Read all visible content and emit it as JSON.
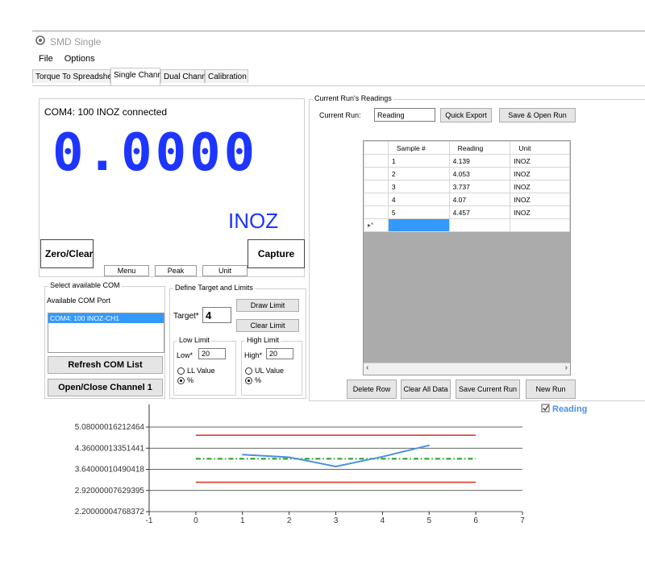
{
  "window": {
    "title": "SMD Single"
  },
  "menu": [
    "File",
    "Options"
  ],
  "tabs": [
    "Torque To Spreadsheet",
    "Single Channel",
    "Dual Channel",
    "Calibration"
  ],
  "display": {
    "status": "COM4: 100 INOZ connected",
    "reading": "0.0000",
    "unit": "INOZ",
    "zero_clear": "Zero/Clear",
    "capture": "Capture",
    "menu_btn": "Menu",
    "peak_btn": "Peak",
    "unit_btn": "Unit"
  },
  "com": {
    "group_title": "Select available COM",
    "label": "Available COM Port",
    "ports": [
      "COM4: 100 INOZ-CH1"
    ],
    "refresh": "Refresh COM List",
    "open_close": "Open/Close Channel 1"
  },
  "target": {
    "group_title": "Define Target and Limits",
    "target_label": "Target*",
    "target_value": "4",
    "draw_limit": "Draw Limit",
    "clear_limit": "Clear Limit",
    "low": {
      "title": "Low Limit",
      "label": "Low*",
      "value": "20",
      "opt1": "LL Value",
      "opt2": "%"
    },
    "high": {
      "title": "High Limit",
      "label": "High*",
      "value": "20",
      "opt1": "UL Value",
      "opt2": "%"
    }
  },
  "readings": {
    "group_title": "Current Run's Readings",
    "current_run_label": "Current Run:",
    "current_run_value": "Reading",
    "quick_export": "Quick Export",
    "save_open": "Save & Open Run",
    "columns": [
      "Sample #",
      "Reading",
      "Unit"
    ],
    "rows": [
      [
        "1",
        "4.139",
        "INOZ"
      ],
      [
        "2",
        "4.053",
        "INOZ"
      ],
      [
        "3",
        "3.737",
        "INOZ"
      ],
      [
        "4",
        "4.07",
        "INOZ"
      ],
      [
        "5",
        "4.457",
        "INOZ"
      ]
    ],
    "new_row_marker": "▸*",
    "delete_row": "Delete Row",
    "clear_all": "Clear All Data",
    "save_current": "Save Current Run",
    "new_run": "New Run"
  },
  "colors": {
    "accent": "#1e35ff",
    "series": "#4a90e2",
    "limit": "#e03a2e",
    "target": "#1f9e1f"
  },
  "chart_data": {
    "type": "line",
    "legend": "Reading",
    "legend_position": "top-right",
    "x": [
      1,
      2,
      3,
      4,
      5
    ],
    "series": [
      {
        "name": "Reading",
        "values": [
          4.139,
          4.053,
          3.737,
          4.07,
          4.457
        ]
      }
    ],
    "upper_limit": 4.8,
    "lower_limit": 3.2,
    "target": 4,
    "limits_x_range": [
      0,
      6
    ],
    "xlim": [
      -1,
      7
    ],
    "ylim": [
      2.20000004768372,
      5.08000016212464
    ],
    "x_ticks": [
      "-1",
      "0",
      "1",
      "2",
      "3",
      "4",
      "5",
      "6",
      "7"
    ],
    "y_ticks": [
      "5.08000016212464",
      "4.36000013351441",
      "3.64000010490418",
      "2.92000007629395",
      "2.20000004768372"
    ],
    "grid": "horizontal"
  }
}
